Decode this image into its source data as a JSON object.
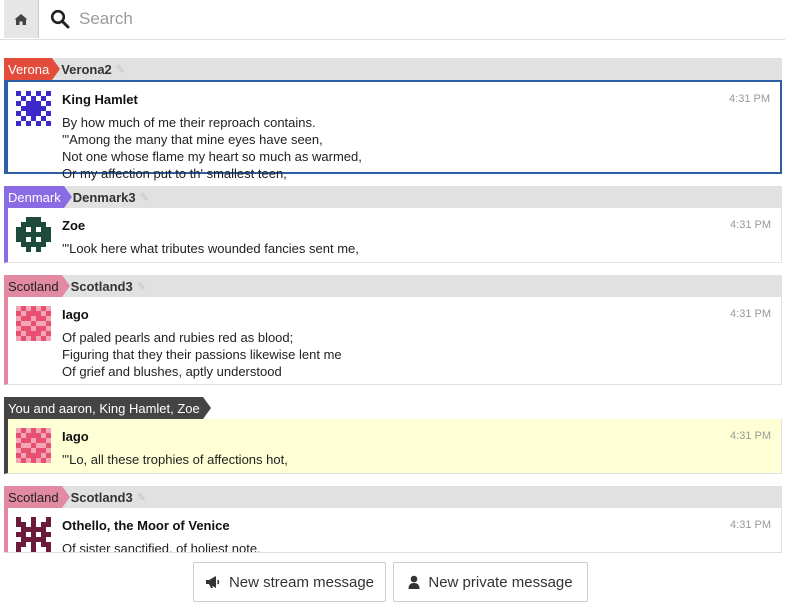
{
  "topbar": {
    "home_icon": "home-icon",
    "search_icon": "search-icon",
    "search_placeholder": "Search"
  },
  "colors": {
    "verona": "#e34b3a",
    "denmark": "#8a6be4",
    "scotland": "#e38aa3",
    "private_bg": "#ffffd6",
    "selected_border": "#2e5ea3"
  },
  "groups": [
    {
      "stream": "Verona",
      "topic": "Verona2",
      "message": {
        "sender": "King Hamlet",
        "time": "4:31 PM",
        "lines": [
          "By how much of me their reproach contains.",
          "'\"Among the many that mine eyes have seen,",
          "Not one whose flame my heart so much as warmed,",
          "Or my affection put to th' smallest teen,"
        ]
      }
    },
    {
      "stream": "Denmark",
      "topic": "Denmark3",
      "message": {
        "sender": "Zoe",
        "time": "4:31 PM",
        "lines": [
          "'\"Look here what tributes wounded fancies sent me,"
        ]
      }
    },
    {
      "stream": "Scotland",
      "topic": "Scotland3",
      "message": {
        "sender": "Iago",
        "time": "4:31 PM",
        "lines": [
          "Of paled pearls and rubies red as blood;",
          "Figuring that they their passions likewise lent me",
          "Of grief and blushes, aptly understood"
        ]
      }
    },
    {
      "private_label": "You and aaron, King Hamlet, Zoe",
      "message": {
        "sender": "Iago",
        "time": "4:31 PM",
        "lines": [
          "'\"Lo, all these trophies of affections hot,"
        ]
      }
    },
    {
      "stream": "Scotland",
      "topic": "Scotland3",
      "message": {
        "sender": "Othello, the Moor of Venice",
        "time": "4:31 PM",
        "lines": [
          "Of sister sanctified, of holiest note,"
        ]
      }
    }
  ],
  "compose": {
    "stream_button": "New stream message",
    "stream_icon": "megaphone-icon",
    "private_button": "New private message",
    "private_icon": "user-icon"
  }
}
